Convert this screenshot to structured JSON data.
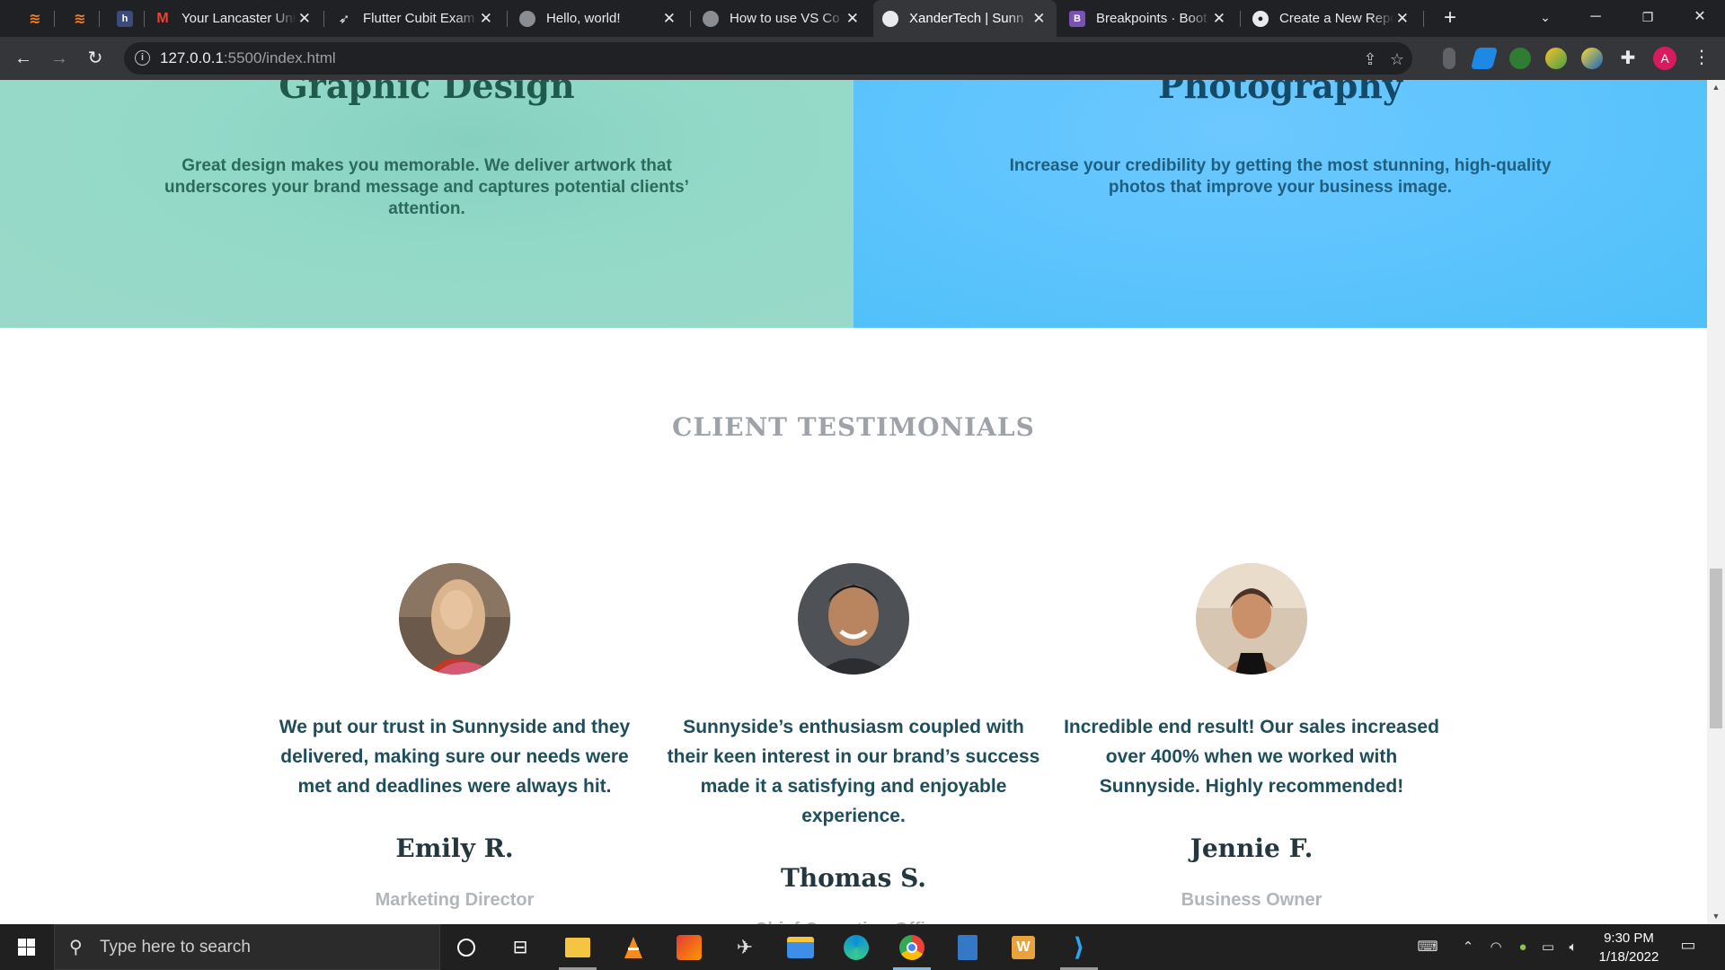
{
  "browser": {
    "tabs": [
      {
        "title": "",
        "icon": "stackoverflow-icon",
        "active": false
      },
      {
        "title": "",
        "icon": "stackoverflow-icon",
        "active": false
      },
      {
        "title": "",
        "icon": "devhints-icon",
        "active": false
      },
      {
        "title": "Your Lancaster Uni",
        "icon": "gmail-icon",
        "active": false
      },
      {
        "title": "Flutter Cubit Exam",
        "icon": "rocket-icon",
        "active": false
      },
      {
        "title": "Hello, world!",
        "icon": "globe-icon",
        "active": false
      },
      {
        "title": "How to use VS Co",
        "icon": "globe-icon",
        "active": false
      },
      {
        "title": "XanderTech | Sunn",
        "icon": "page-icon",
        "active": true
      },
      {
        "title": "Breakpoints · Boot",
        "icon": "bootstrap-icon",
        "active": false
      },
      {
        "title": "Create a New Repo",
        "icon": "github-icon",
        "active": false
      }
    ],
    "url_host": "127.0.0.1",
    "url_path": ":5500/index.html",
    "profile_initial": "A",
    "tab_close_glyph": "✕",
    "new_tab_glyph": "+"
  },
  "services": {
    "graphic": {
      "title": "Graphic Design",
      "text": "Great design makes you memorable. We deliver artwork that underscores your brand message and captures potential clients’ attention.",
      "color": "#93d9c8"
    },
    "photography": {
      "title": "Photography",
      "text": "Increase your credibility by getting the most stunning, high-quality photos that improve your business image.",
      "color": "#5fc4fd"
    }
  },
  "testimonials": {
    "heading": "CLIENT TESTIMONIALS",
    "items": [
      {
        "quote": "We put our trust in Sunnyside and they delivered, making sure our needs were met and deadlines were always hit.",
        "name": "Emily R.",
        "role": "Marketing Director"
      },
      {
        "quote": "Sunnyside’s enthusiasm coupled with their keen interest in our brand’s success made it a satisfying and enjoyable experience.",
        "name": "Thomas S.",
        "role": "Chief Operating Officer"
      },
      {
        "quote": "Incredible end result! Our sales increased over 400% when we worked with Sunnyside. Highly recommended!",
        "name": "Jennie F.",
        "role": "Business Owner"
      }
    ]
  },
  "taskbar": {
    "search_placeholder": "Type here to search",
    "time": "9:30 PM",
    "date": "1/18/2022"
  }
}
